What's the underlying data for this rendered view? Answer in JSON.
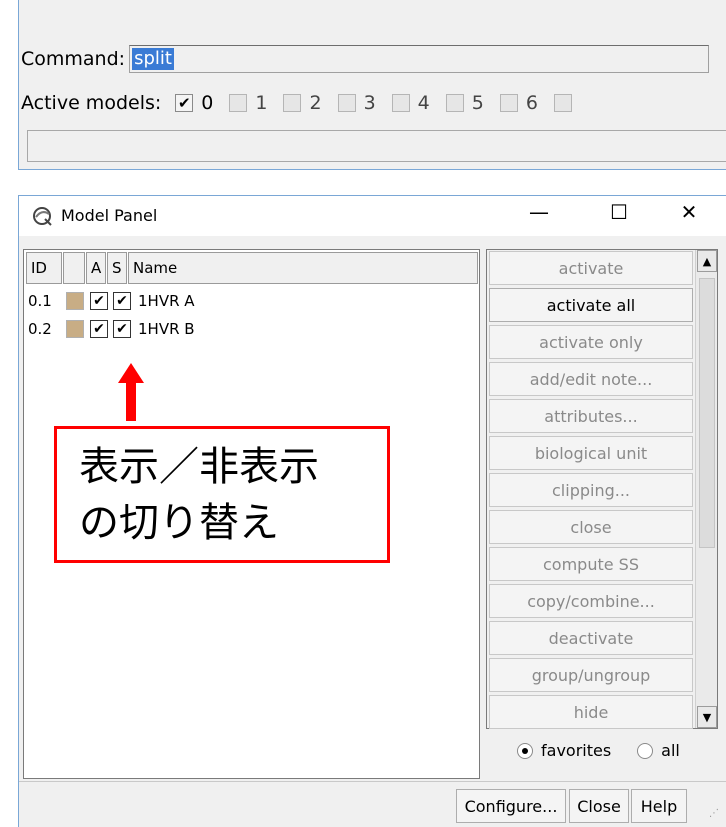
{
  "command_window": {
    "command_label": "Command:",
    "command_value": "split",
    "active_models_label": "Active models:",
    "models": [
      {
        "label": "0",
        "checked": true
      },
      {
        "label": "1",
        "checked": false
      },
      {
        "label": "2",
        "checked": false
      },
      {
        "label": "3",
        "checked": false
      },
      {
        "label": "4",
        "checked": false
      },
      {
        "label": "5",
        "checked": false
      },
      {
        "label": "6",
        "checked": false
      }
    ]
  },
  "model_panel": {
    "title": "Model Panel",
    "window_controls": {
      "minimize": "—",
      "maximize": "☐",
      "close": "✕"
    },
    "icon": "chimera-logo-icon",
    "columns": {
      "id": "ID",
      "active": "A",
      "shown": "S",
      "name": "Name"
    },
    "rows": [
      {
        "id": "0.1",
        "color": "#c8ad85",
        "active": true,
        "shown": true,
        "name": "1HVR A"
      },
      {
        "id": "0.2",
        "color": "#c8ad85",
        "active": true,
        "shown": true,
        "name": "1HVR B"
      }
    ],
    "annotation": {
      "line1": "表示／非表示",
      "line2": "の切り替え",
      "color": "#ff0000"
    },
    "commands": [
      {
        "label": "activate",
        "enabled": false
      },
      {
        "label": "activate all",
        "enabled": true
      },
      {
        "label": "activate only",
        "enabled": false
      },
      {
        "label": "add/edit note...",
        "enabled": false
      },
      {
        "label": "attributes...",
        "enabled": false
      },
      {
        "label": "biological unit",
        "enabled": false
      },
      {
        "label": "clipping...",
        "enabled": false
      },
      {
        "label": "close",
        "enabled": false
      },
      {
        "label": "compute SS",
        "enabled": false
      },
      {
        "label": "copy/combine...",
        "enabled": false
      },
      {
        "label": "deactivate",
        "enabled": false
      },
      {
        "label": "group/ungroup",
        "enabled": false
      },
      {
        "label": "hide",
        "enabled": false
      }
    ],
    "filter": {
      "favorites_label": "favorites",
      "all_label": "all",
      "selected": "favorites"
    },
    "buttons": {
      "configure": "Configure...",
      "close": "Close",
      "help": "Help"
    }
  }
}
